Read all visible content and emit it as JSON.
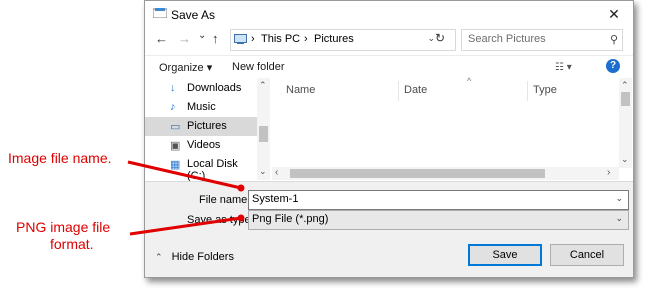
{
  "window": {
    "title": "Save As",
    "close": "✕"
  },
  "nav": {
    "back": "←",
    "forward": "→",
    "recent": "⌄",
    "up": "↑",
    "breadcrumb": [
      "This PC",
      "Pictures"
    ],
    "separator": "›",
    "search_placeholder": "Search Pictures"
  },
  "toolbar": {
    "organize": "Organize ▾",
    "new_folder": "New folder",
    "view": "☷ ▾",
    "help": "?"
  },
  "sidebar": {
    "items": [
      {
        "label": "Downloads",
        "icon": "↓"
      },
      {
        "label": "Music",
        "icon": "♪"
      },
      {
        "label": "Pictures",
        "icon": "▭"
      },
      {
        "label": "Videos",
        "icon": "▣"
      },
      {
        "label": "Local Disk (C:)",
        "icon": "▦"
      }
    ],
    "selected": "Pictures"
  },
  "content": {
    "columns": [
      "Name",
      "Date",
      "Type"
    ]
  },
  "footer": {
    "file_name_label": "File name:",
    "file_name_value": "System-1",
    "save_type_label": "Save as type:",
    "save_type_value": "Png File (*.png)",
    "hide_folders": "Hide Folders",
    "save": "Save",
    "cancel": "Cancel"
  },
  "annotations": {
    "file_name": "Image file name.",
    "file_format_line1": "PNG image file",
    "file_format_line2": "format."
  },
  "colors": {
    "annotation": "#e00000",
    "accent": "#0078d7"
  }
}
